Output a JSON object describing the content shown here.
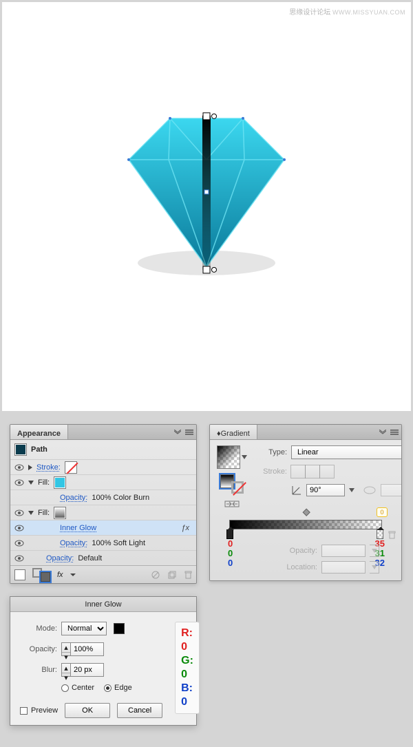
{
  "watermark": {
    "cn": "思缘设计论坛",
    "en": "WWW.MISSYUAN.COM"
  },
  "appearance": {
    "title": "Appearance",
    "object": "Path",
    "stroke_label": "Stroke:",
    "fill_label": "Fill:",
    "opacity_label": "Opacity:",
    "opacity1": "100% Color Burn",
    "inner_glow_label": "Inner Glow",
    "opacity2": "100% Soft Light",
    "opacity3": "Default",
    "fx_symbol": "ƒx",
    "footer_fx": "fx"
  },
  "gradient": {
    "title": "Gradient",
    "type_label": "Type:",
    "type_value": "Linear",
    "stroke_label": "Stroke:",
    "angle_value": "90°",
    "opacity_label": "Opacity:",
    "location_label": "Location:",
    "top_bubble": "0",
    "left_rgb": {
      "r": "0",
      "g": "0",
      "b": "0"
    },
    "right_rgb": {
      "r": "35",
      "g": "31",
      "b": "32"
    }
  },
  "inner_glow": {
    "title": "Inner Glow",
    "mode_label": "Mode:",
    "mode_value": "Normal",
    "opacity_label": "Opacity:",
    "opacity_value": "100%",
    "blur_label": "Blur:",
    "blur_value": "20 px",
    "center_label": "Center",
    "edge_label": "Edge",
    "preview_label": "Preview",
    "ok_label": "OK",
    "cancel_label": "Cancel",
    "rgb": {
      "r": "R: 0",
      "g": "G: 0",
      "b": "B: 0"
    }
  }
}
